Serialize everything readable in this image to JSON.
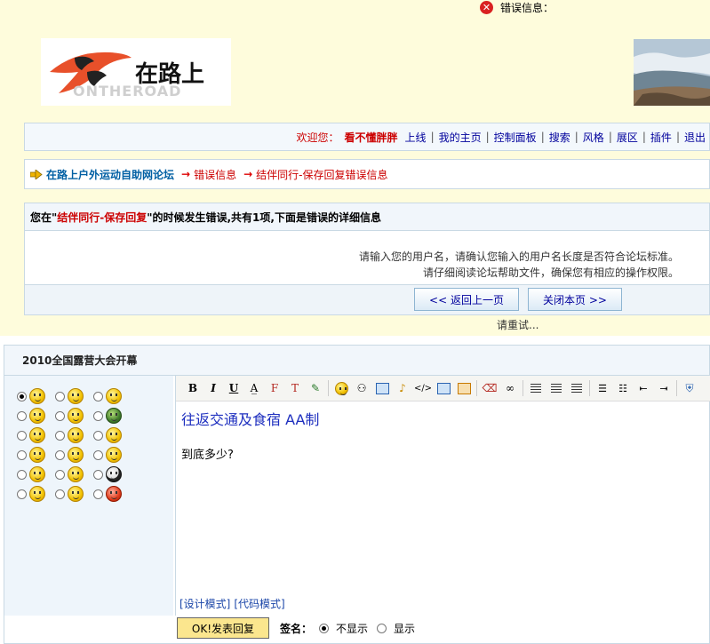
{
  "error_header": "错误信息：",
  "logo": {
    "name": "在路上",
    "ghost": "ONTHEROAD"
  },
  "user_bar": {
    "welcome": "欢迎您：",
    "username": "看不懂胖胖",
    "links": [
      "上线",
      "我的主页",
      "控制面板",
      "搜索",
      "风格",
      "展区",
      "插件",
      "退出"
    ]
  },
  "breadcrumb": {
    "forum": "在路上户外运动自助网论坛",
    "items": [
      "错误信息",
      "结伴同行-保存回复错误信息"
    ]
  },
  "error_box": {
    "prefix": "您在\"",
    "action": "结伴同行-保存回复",
    "suffix": "\"的时候发生错误,共有1项,下面是错误的详细信息",
    "messages": [
      "请输入您的用户名，请确认您输入的用户名长度是否符合论坛标准。",
      "请仔细阅读论坛帮助文件，确保您有相应的操作权限。"
    ],
    "back_button": "<< 返回上一页",
    "close_button": "关闭本页 >>",
    "retry": "请重试..."
  },
  "thread": {
    "title": "2010全国露营大会开幕"
  },
  "editor": {
    "line1": "往返交通及食宿 AA制",
    "line2": "到底多少?",
    "design_mode": "[设计模式]",
    "code_mode": "[代码模式]"
  },
  "submit": {
    "button": "OK!发表回复",
    "signature_label": "签名：",
    "options": [
      "不显示",
      "显示"
    ]
  },
  "colors": {
    "accent_red": "#cc0000",
    "link_blue": "#00009c",
    "top_bg": "#fefcdc"
  }
}
